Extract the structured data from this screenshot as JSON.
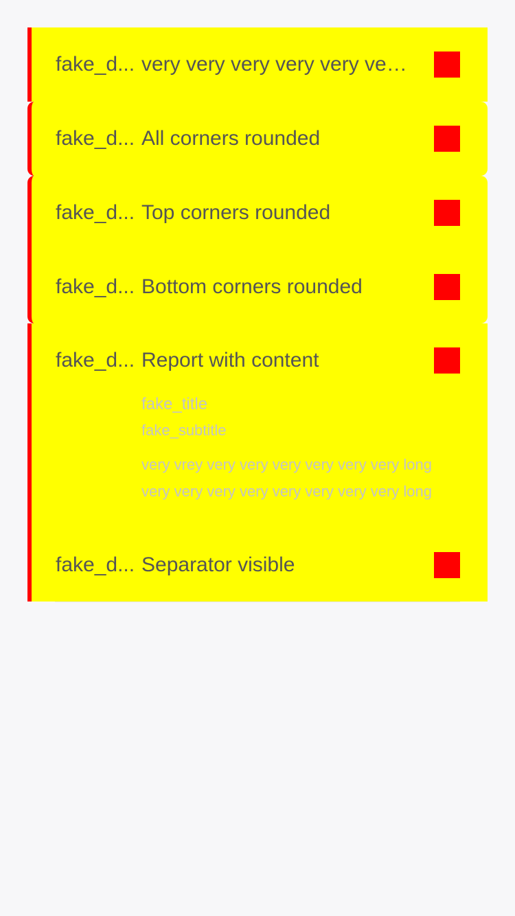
{
  "rows": [
    {
      "date": "fake_d...",
      "title": "very very very very very very very long title"
    },
    {
      "date": "fake_d...",
      "title": "All corners rounded"
    },
    {
      "date": "fake_d...",
      "title": "Top corners rounded"
    },
    {
      "date": "fake_d...",
      "title": "Bottom corners rounded"
    },
    {
      "date": "fake_d...",
      "title": "Report with content",
      "content": {
        "title": "fake_title",
        "subtitle": "fake_subtitle",
        "line1": "very vrey very very very very very very long",
        "line2": "very very very very very very very very long"
      }
    },
    {
      "date": "fake_d...",
      "title": "Separator visible"
    }
  ],
  "colors": {
    "background": "#f7f7f9",
    "cell": "#ffff00",
    "accent": "#ff0000",
    "text": "#555555",
    "content_text": "#c4c4c4"
  }
}
